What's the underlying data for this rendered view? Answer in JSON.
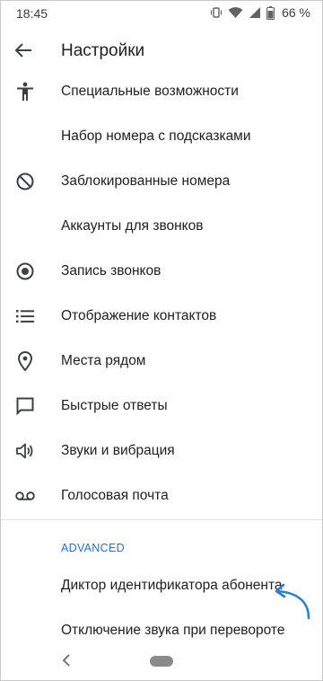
{
  "status_bar": {
    "time": "18:45",
    "battery": "66 %",
    "icons": [
      "vibrate-icon",
      "wifi-icon",
      "signal-icon",
      "battery-icon"
    ]
  },
  "app_bar": {
    "back_icon": "back-arrow-icon",
    "title": "Настройки"
  },
  "settings": {
    "items": [
      {
        "icon": "accessibility-icon",
        "label": "Специальные возможности"
      },
      {
        "icon": "",
        "label": "Набор номера с подсказками"
      },
      {
        "icon": "block-icon",
        "label": "Заблокированные номера"
      },
      {
        "icon": "",
        "label": "Аккаунты для звонков"
      },
      {
        "icon": "record-icon",
        "label": "Запись звонков"
      },
      {
        "icon": "list-icon",
        "label": "Отображение контактов"
      },
      {
        "icon": "location-pin-icon",
        "label": "Места рядом"
      },
      {
        "icon": "chat-bubble-icon",
        "label": "Быстрые ответы"
      },
      {
        "icon": "volume-icon",
        "label": "Звуки и вибрация"
      },
      {
        "icon": "voicemail-icon",
        "label": "Голосовая почта"
      }
    ]
  },
  "advanced": {
    "header": "ADVANCED",
    "items": [
      {
        "label": "Диктор идентификатора абонента"
      },
      {
        "label": "Отключение звука при перевороте"
      }
    ]
  },
  "colors": {
    "accent": "#1a73e8",
    "text": "#202124",
    "icon": "#3c4043",
    "annotation_arrow": "#2d7fd3"
  }
}
